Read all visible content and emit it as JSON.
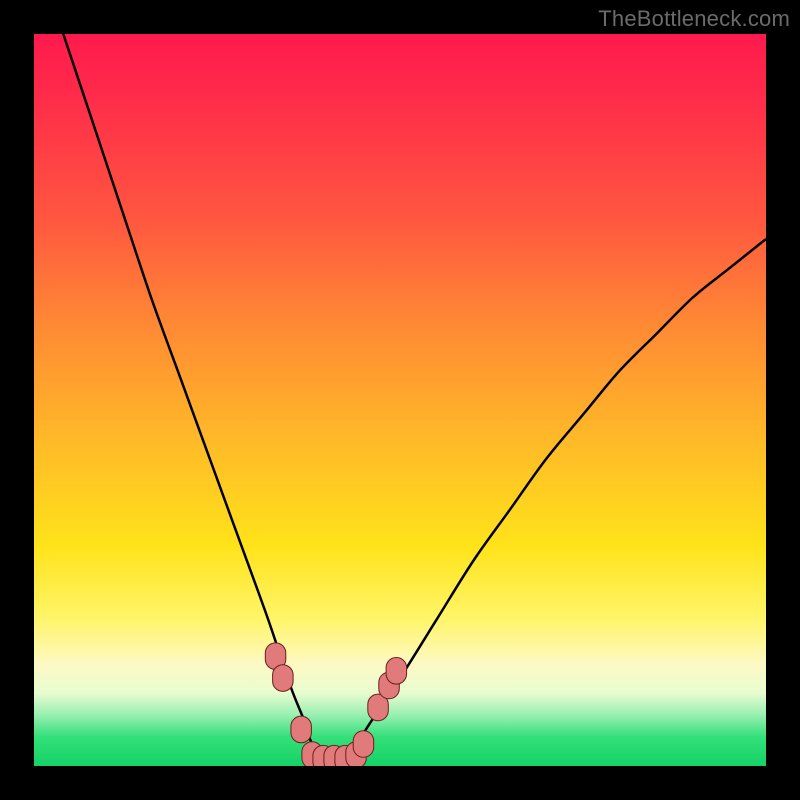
{
  "watermark": "TheBottleneck.com",
  "colors": {
    "background": "#000000",
    "curve_stroke": "#000000",
    "marker_fill": "#e17a7a",
    "marker_stroke": "#6b1f1f",
    "gradient_top": "#ff1a4d",
    "gradient_mid": "#ffe31a",
    "gradient_bottom": "#14d267"
  },
  "chart_data": {
    "type": "line",
    "title": "",
    "xlabel": "",
    "ylabel": "",
    "xlim": [
      0,
      100
    ],
    "ylim": [
      0,
      100
    ],
    "grid": false,
    "legend_position": "none",
    "annotations": [],
    "series": [
      {
        "name": "curve",
        "x": [
          4,
          8,
          12,
          16,
          20,
          24,
          28,
          32,
          35,
          37,
          38,
          40,
          42,
          44,
          46,
          50,
          55,
          60,
          65,
          70,
          75,
          80,
          85,
          90,
          95,
          100
        ],
        "values": [
          100,
          88,
          76,
          64,
          53,
          42,
          31,
          20,
          11,
          6,
          3,
          1,
          1,
          3,
          6,
          12,
          20,
          28,
          35,
          42,
          48,
          54,
          59,
          64,
          68,
          72
        ]
      }
    ],
    "markers": [
      {
        "x": 33,
        "y": 15
      },
      {
        "x": 34,
        "y": 12
      },
      {
        "x": 36.5,
        "y": 5
      },
      {
        "x": 38,
        "y": 1.5
      },
      {
        "x": 39.5,
        "y": 1
      },
      {
        "x": 41,
        "y": 1
      },
      {
        "x": 42.5,
        "y": 1
      },
      {
        "x": 44,
        "y": 1.5
      },
      {
        "x": 45,
        "y": 3
      },
      {
        "x": 47,
        "y": 8
      },
      {
        "x": 48.5,
        "y": 11
      },
      {
        "x": 49.5,
        "y": 13
      }
    ],
    "marker_radius": 1.4
  }
}
